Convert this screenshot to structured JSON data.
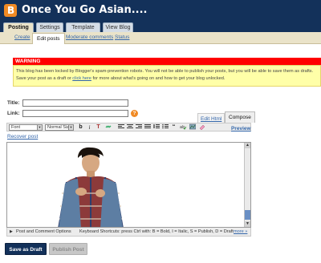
{
  "blog": {
    "title": "Once You Go Asian...."
  },
  "tabs": [
    {
      "label": "Posting"
    },
    {
      "label": "Settings"
    },
    {
      "label": "Template"
    },
    {
      "label": "View Blog"
    }
  ],
  "subtabs": [
    {
      "label": "Create"
    },
    {
      "label": "Edit posts"
    },
    {
      "label": "Moderate comments"
    },
    {
      "label": "Status"
    }
  ],
  "warning": {
    "title": "WARNING",
    "line1": "This blog has been locked by Blogger's spam-prevention robots. You will not be able to publish your posts, but you will be able to save them as drafts.",
    "line2_before": "Save your post as a draft or ",
    "line2_link": "click here",
    "line2_after": " for more about what's going on and how to get your blog unlocked."
  },
  "form": {
    "title_label": "Title:",
    "title_value": "",
    "link_label": "Link:",
    "link_value": ""
  },
  "modes": {
    "edit_html": "Edit Html",
    "compose": "Compose"
  },
  "toolbar": {
    "font_select": "Font",
    "size_select": "Normal Size",
    "bold": "b",
    "italic": "i",
    "text_color": "T",
    "link": "🔗",
    "preview": "Preview"
  },
  "recover_post": "Recover post",
  "footer": {
    "post_options": "Post and Comment Options",
    "shortcuts": "Keyboard Shortcuts: press Ctrl with: B = Bold,   I = Italic,   S = Publish,   D = Draft",
    "more": "more »"
  },
  "buttons": {
    "save_draft": "Save as Draft",
    "publish": "Publish Post"
  },
  "colors": {
    "header": "#13315a",
    "accent": "#f08a24",
    "warning_red": "#ff0000",
    "warning_bg": "#ffffa8"
  }
}
